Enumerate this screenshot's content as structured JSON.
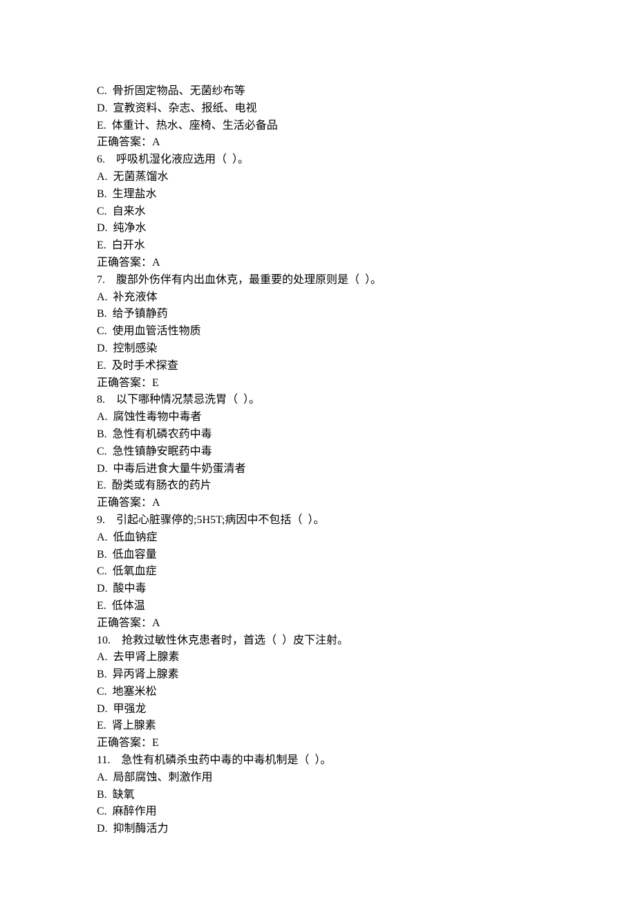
{
  "lines": [
    "C.  骨折固定物品、无菌纱布等",
    "D.  宣教资料、杂志、报纸、电视",
    "E.  体重计、热水、座椅、生活必备品",
    "正确答案：A",
    "6.　呼吸机湿化液应选用（  ）。",
    "A.  无菌蒸馏水",
    "B.  生理盐水",
    "C.  自来水",
    "D.  纯净水",
    "E.  白开水",
    "正确答案：A",
    "7.　腹部外伤伴有内出血休克，最重要的处理原则是（  ）。",
    "A.  补充液体",
    "B.  给予镇静药",
    "C.  使用血管活性物质",
    "D.  控制感染",
    "E.  及时手术探查",
    "正确答案：E",
    "8.　以下哪种情况禁忌洗胃（  ）。",
    "A.  腐蚀性毒物中毒者",
    "B.  急性有机磷农药中毒",
    "C.  急性镇静安眠药中毒",
    "D.  中毒后进食大量牛奶蛋清者",
    "E.  酚类或有肠衣的药片",
    "正确答案：A",
    "9.　引起心脏骤停的;5H5T;病因中不包括（  ）。",
    "A.  低血钠症",
    "B.  低血容量",
    "C.  低氧血症",
    "D.  酸中毒",
    "E.  低体温",
    "正确答案：A",
    "10.　抢救过敏性休克患者时，首选（  ）皮下注射。",
    "A.  去甲肾上腺素",
    "B.  异丙肾上腺素",
    "C.  地塞米松",
    "D.  甲强龙",
    "E.  肾上腺素",
    "正确答案：E",
    "11.　急性有机磷杀虫药中毒的中毒机制是（  ）。",
    "A.  局部腐蚀、刺激作用",
    "B.  缺氧",
    "C.  麻醉作用",
    "D.  抑制酶活力"
  ]
}
